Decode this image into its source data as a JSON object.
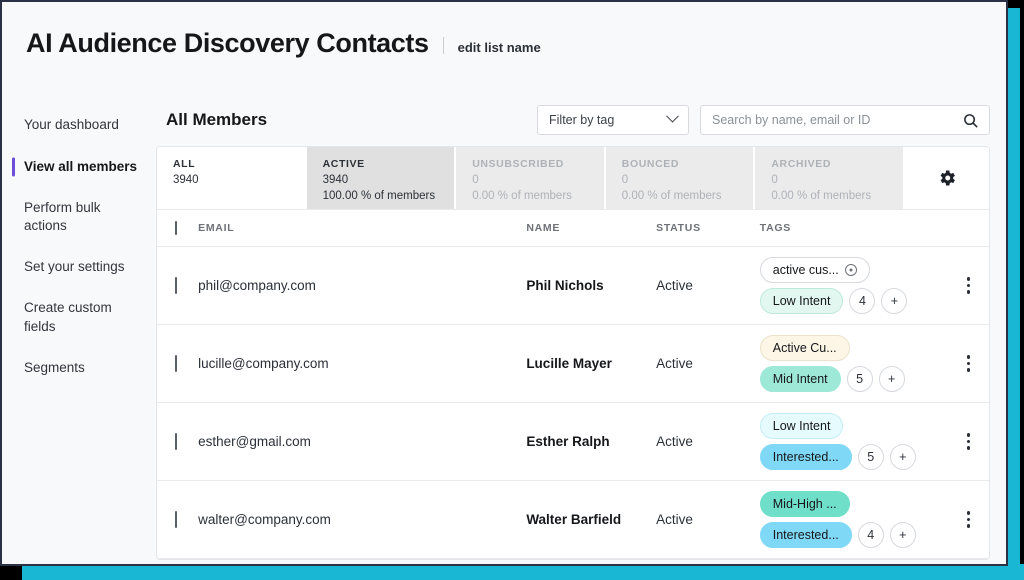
{
  "header": {
    "title": "AI Audience Discovery Contacts",
    "edit_link": "edit list name"
  },
  "sidebar": {
    "items": [
      {
        "label": "Your dashboard",
        "active": false
      },
      {
        "label": "View all members",
        "active": true
      },
      {
        "label": "Perform bulk actions",
        "active": false
      },
      {
        "label": "Set your settings",
        "active": false
      },
      {
        "label": "Create custom fields",
        "active": false
      },
      {
        "label": "Segments",
        "active": false
      }
    ]
  },
  "toolbar": {
    "section_title": "All Members",
    "filter_label": "Filter by tag",
    "search_placeholder": "Search by name, email or ID",
    "search_value": ""
  },
  "stats": [
    {
      "name": "ALL",
      "count": "3940",
      "pct": "",
      "state": "selected"
    },
    {
      "name": "ACTIVE",
      "count": "3940",
      "pct": "100.00 % of members",
      "state": "current"
    },
    {
      "name": "UNSUBSCRIBED",
      "count": "0",
      "pct": "0.00 % of members",
      "state": "muted"
    },
    {
      "name": "BOUNCED",
      "count": "0",
      "pct": "0.00 % of members",
      "state": "muted"
    },
    {
      "name": "ARCHIVED",
      "count": "0",
      "pct": "0.00 % of members",
      "state": "muted"
    }
  ],
  "table": {
    "columns": [
      "EMAIL",
      "NAME",
      "STATUS",
      "TAGS"
    ],
    "rows": [
      {
        "email": "phil@company.com",
        "name": "Phil Nichols",
        "status": "Active",
        "tag_top": "active cus...",
        "tag_top_style": "plain",
        "tag_top_removable": true,
        "tag_bottom": "Low Intent",
        "tag_bottom_style": "mint-pale",
        "count": "4",
        "add": "+"
      },
      {
        "email": "lucille@company.com",
        "name": "Lucille Mayer",
        "status": "Active",
        "tag_top": "Active Cu...",
        "tag_top_style": "cream",
        "tag_top_removable": false,
        "tag_bottom": "Mid Intent",
        "tag_bottom_style": "mint",
        "count": "5",
        "add": "+"
      },
      {
        "email": "esther@gmail.com",
        "name": "Esther Ralph",
        "status": "Active",
        "tag_top": "Low Intent",
        "tag_top_style": "pale-sky",
        "tag_top_removable": false,
        "tag_bottom": "Interested...",
        "tag_bottom_style": "sky",
        "count": "5",
        "add": "+"
      },
      {
        "email": "walter@company.com",
        "name": "Walter Barfield",
        "status": "Active",
        "tag_top": "Mid-High ...",
        "tag_top_style": "teal",
        "tag_top_removable": false,
        "tag_bottom": "Interested...",
        "tag_bottom_style": "sky",
        "count": "4",
        "add": "+"
      }
    ]
  },
  "colors": {
    "accent": "#1ab7d4",
    "active_nav": "#6b4fd8",
    "frame": "#2b3245"
  }
}
